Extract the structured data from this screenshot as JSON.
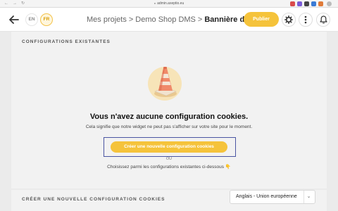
{
  "browser": {
    "url": "admin.axeptio.eu",
    "nav_back": "←",
    "nav_forward": "→",
    "nav_reload": "↻"
  },
  "header": {
    "back_icon": "arrow-left-icon",
    "languages": [
      "EN",
      "FR"
    ],
    "active_language": "FR",
    "breadcrumb": [
      "Mes projets",
      "Demo Shop DMS",
      "Bannière de cooki"
    ],
    "breadcrumb_separator": ">",
    "publish_label": "Publier",
    "accent_color": "#f5c33b"
  },
  "main": {
    "section_title": "CONFIGURATIONS EXISTANTES",
    "empty_title": "Vous n'avez aucune configuration cookies.",
    "empty_desc": "Cela signifie que notre widget ne peut pas s'afficher sur votre site pour le moment.",
    "create_label": "Créer une nouvelle configuration cookies",
    "or_label": "OU",
    "choose_text": "Choisissez parmi les configurations existantes ci-dessous",
    "choose_icon": "👇"
  },
  "bottom": {
    "section_title": "CRÉER UNE NOUVELLE CONFIGURATION COOKIES",
    "region_value": "Anglais - Union européenne"
  }
}
